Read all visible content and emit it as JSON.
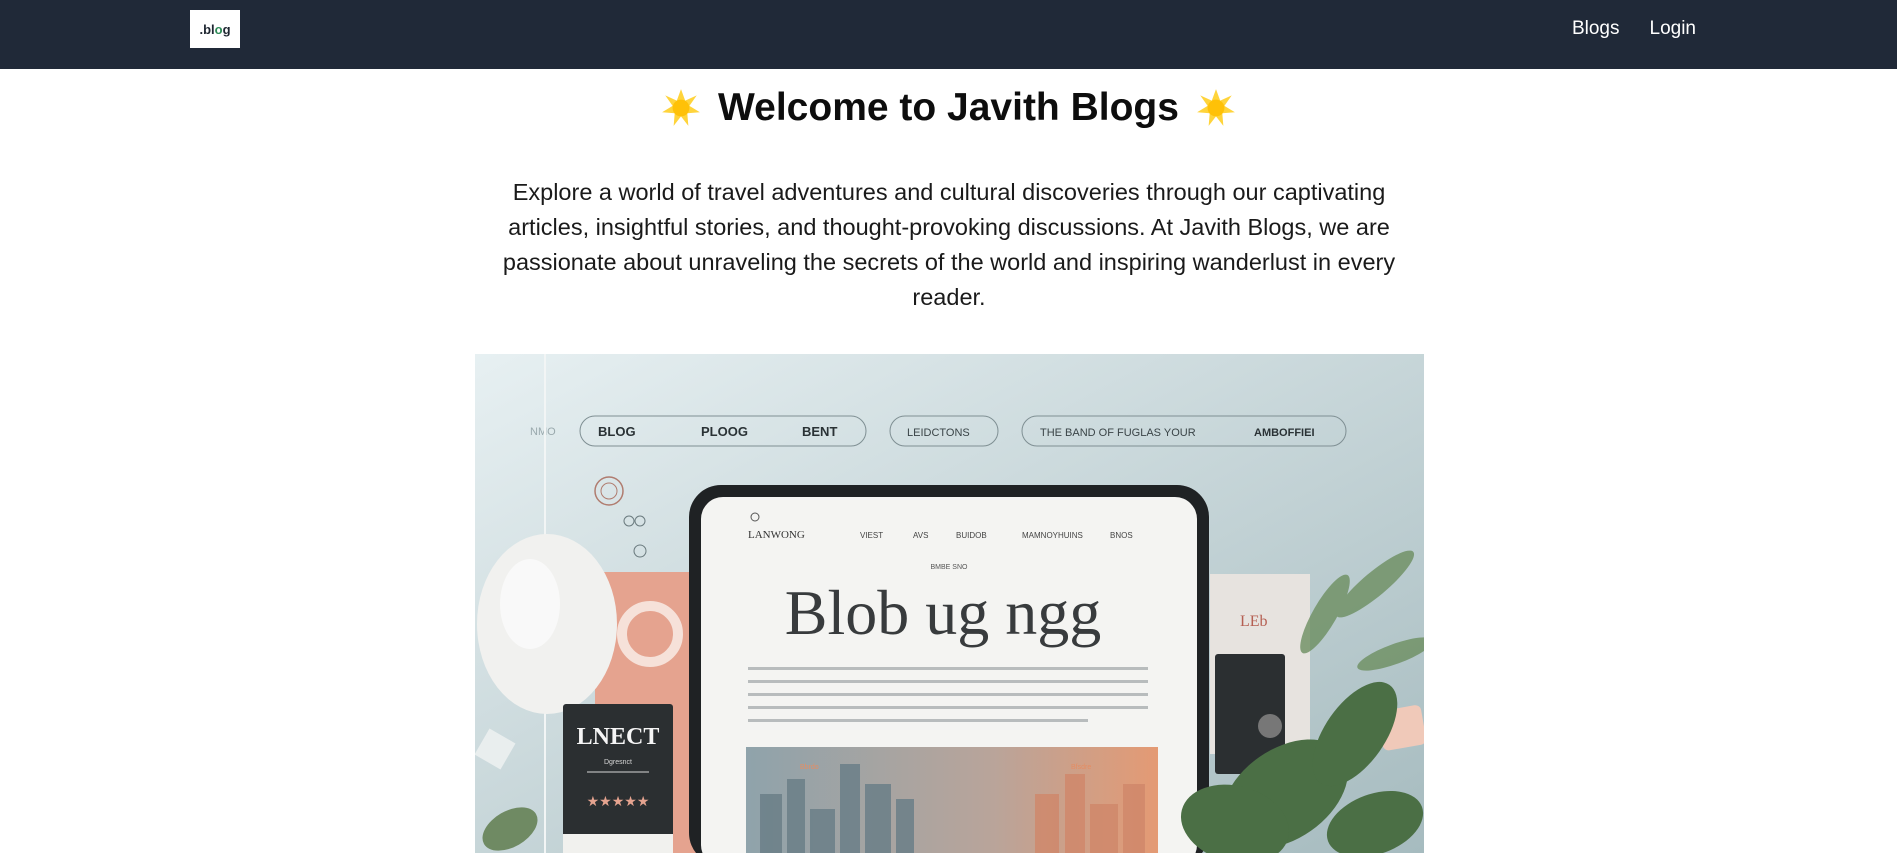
{
  "nav": {
    "logo_prefix": ".bl",
    "logo_dot": "o",
    "logo_suffix": "g",
    "links": [
      {
        "label": "Blogs"
      },
      {
        "label": "Login"
      }
    ]
  },
  "hero": {
    "title": "Welcome to Javith Blogs",
    "sparkle_icon": "sparkle-emoji",
    "intro": "Explore a world of travel adventures and cultural discoveries through our captivating articles, insightful stories, and thought-provoking discussions. At Javith Blogs, we are passionate about unraveling the secrets of the world and inspiring wanderlust in every reader."
  },
  "image": {
    "menu_pills": [
      "BLOG",
      "PLOOG",
      "BENT",
      "LEIDCTONS",
      "THE BAND OF FUGLAS YOUR",
      "AMBOFFIEI"
    ],
    "menu_faded": "NMO",
    "tablet_brand": "LANWONG",
    "tablet_nav": [
      "VIEST",
      "AVS",
      "BUIDOB",
      "MAMNOYHUINS",
      "BNOS"
    ],
    "tablet_kicker": "BMBE SNO",
    "tablet_headline": "Blob ug ngg",
    "card_title": "LNECT",
    "card_sub": "Dgresnct",
    "card_stars": "★★★★★",
    "colors": {
      "navbar": "#202938",
      "bg_teal": "#b7c9cd",
      "peach": "#e5a38f"
    }
  }
}
